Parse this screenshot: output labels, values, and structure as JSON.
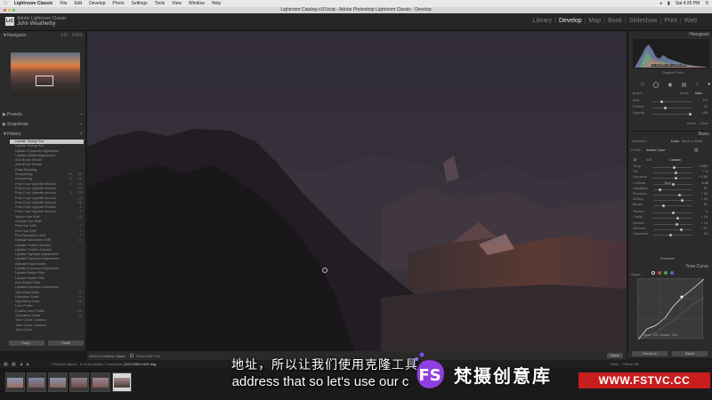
{
  "menubar": {
    "app_name": "Lightroom Classic",
    "items": [
      "File",
      "Edit",
      "Develop",
      "Photo",
      "Settings",
      "Tools",
      "View",
      "Window",
      "Help"
    ],
    "clock": "Sat 4:25 PM"
  },
  "window": {
    "title": "Lightroom Catalog-v10.lrcat - Adobe Photoshop Lightroom Classic - Develop"
  },
  "identity_plate": {
    "badge": "LrC",
    "line1": "Adobe Lightroom Classic",
    "name": "John Weatherby"
  },
  "modules": [
    {
      "label": "Library",
      "active": false
    },
    {
      "label": "Develop",
      "active": true
    },
    {
      "label": "Map",
      "active": false
    },
    {
      "label": "Book",
      "active": false
    },
    {
      "label": "Slideshow",
      "active": false
    },
    {
      "label": "Print",
      "active": false
    },
    {
      "label": "Web",
      "active": false
    }
  ],
  "left_panel": {
    "navigator": {
      "label": "Navigator",
      "zoom": "FIT",
      "zoom2": "100%"
    },
    "presets": "Presets",
    "snapshots": "Snapshots",
    "history": {
      "label": "History",
      "items": [
        {
          "text": "Update Toning Hue",
          "a": "",
          "b": ""
        },
        {
          "text": "Update Toning Hue",
          "a": "",
          "b": ""
        },
        {
          "text": "Update Exposure Adjustment",
          "a": "",
          "b": ""
        },
        {
          "text": "Update Whites Adjustment",
          "a": "",
          "b": ""
        },
        {
          "text": "Add Brush Stroke",
          "a": "",
          "b": ""
        },
        {
          "text": "Add Brush Stroke",
          "a": "",
          "b": ""
        },
        {
          "text": "Edge Masking",
          "a": "",
          "b": ""
        },
        {
          "text": "Sharpening",
          "a": "25",
          "b": "59"
        },
        {
          "text": "Sharpening",
          "a": "10",
          "b": "25"
        },
        {
          "text": "Post-Crop Vignette Amount",
          "a": "-4",
          "b": "-14"
        },
        {
          "text": "Post-Crop Vignette Feather",
          "a": "",
          "b": "53"
        },
        {
          "text": "Post-Crop Vignette Amount",
          "a": "4",
          "b": "-10"
        },
        {
          "text": "Post-Crop Vignette Amount",
          "a": "",
          "b": "-14"
        },
        {
          "text": "Post-Crop Vignette Amount",
          "a": "",
          "b": "-15"
        },
        {
          "text": "Post-Crop Vignette Feather",
          "a": "",
          "b": "0"
        },
        {
          "text": "Post-Crop Vignette Amount",
          "a": "",
          "b": "0"
        },
        {
          "text": "Yellow Hue Shift",
          "a": "",
          "b": "10"
        },
        {
          "text": "Orange Hue Shift",
          "a": "",
          "b": ""
        },
        {
          "text": "Red Hue Shift",
          "a": "",
          "b": "1"
        },
        {
          "text": "Red Hue Shift",
          "a": "",
          "b": "1"
        },
        {
          "text": "Red Saturation Shift",
          "a": "",
          "b": "1"
        },
        {
          "text": "Orange Saturation Shift",
          "a": "",
          "b": "10"
        },
        {
          "text": "Update Feather Amount",
          "a": "",
          "b": ""
        },
        {
          "text": "Update Feather Amount",
          "a": "",
          "b": ""
        },
        {
          "text": "Update Highlight Adjustment",
          "a": "",
          "b": ""
        },
        {
          "text": "Update Exposure Adjustment",
          "a": "",
          "b": ""
        },
        {
          "text": "Activate Mask Mode",
          "a": "",
          "b": ""
        },
        {
          "text": "Update Exposure Adjustment",
          "a": "",
          "b": ""
        },
        {
          "text": "Update Radial Filter",
          "a": "",
          "b": ""
        },
        {
          "text": "Update Radial Filter",
          "a": "",
          "b": ""
        },
        {
          "text": "Add Radial Filter",
          "a": "",
          "b": ""
        },
        {
          "text": "Update Exposure Adjustment",
          "a": "",
          "b": ""
        },
        {
          "text": "Vignetting Scale",
          "a": "",
          "b": "10"
        },
        {
          "text": "Distortion Scale",
          "a": "",
          "b": "10"
        },
        {
          "text": "Vignetting Scale",
          "a": "",
          "b": "10"
        },
        {
          "text": "Lens Profile",
          "a": "",
          "b": ""
        },
        {
          "text": "Enable Lens Profile",
          "a": "",
          "b": "On"
        },
        {
          "text": "Saturation Scale",
          "a": "",
          "b": "10"
        },
        {
          "text": "Tone Curve: Custom",
          "a": "",
          "b": ""
        },
        {
          "text": "Tone Curve: Custom",
          "a": "",
          "b": ""
        },
        {
          "text": "Tone Curve",
          "a": "",
          "b": ""
        }
      ]
    },
    "copy_label": "Copy...",
    "paste_label": "Paste"
  },
  "right_panel": {
    "histogram_label": "Histogram",
    "original_photo": "Original Photo",
    "histogram_readout": [
      "ISO",
      "24 mm",
      "f/8",
      "1/250 sec"
    ],
    "brush": {
      "label": "Brush :",
      "erase": "Erase",
      "new": "New"
    },
    "brush_rows": [
      {
        "label": "Size",
        "value": "5.0"
      },
      {
        "label": "Feather",
        "value": "32"
      },
      {
        "label": "Opacity",
        "value": "100"
      }
    ],
    "reset_label": "Reset",
    "close_label": "Close",
    "basic_label": "Basic",
    "treatment": {
      "label": "Treatment :",
      "color": "Color",
      "bw": "Black & White"
    },
    "profile": {
      "label": "Profile :",
      "value": "Adobe Color"
    },
    "wb": {
      "label": "WB :",
      "value": "Custom"
    },
    "basic_rows": [
      {
        "label": "Temp",
        "value": "3,863"
      },
      {
        "label": "Tint",
        "value": "+ 6"
      },
      {
        "label": "Exposure",
        "value": "+ 0.50"
      },
      {
        "label": "Contrast",
        "value": "0"
      },
      {
        "label": "Highlights",
        "value": "- 87"
      },
      {
        "label": "Shadows",
        "value": "+ 34"
      },
      {
        "label": "Whites",
        "value": "+ 43"
      },
      {
        "label": "Blacks",
        "value": "- 51"
      }
    ],
    "tone_label": "Tone",
    "auto_label": "Auto",
    "presence_label": "Presence",
    "presence_rows": [
      {
        "label": "Texture",
        "value": "0"
      },
      {
        "label": "Clarity",
        "value": "+ 16"
      },
      {
        "label": "Dehaze",
        "value": "+ 13"
      },
      {
        "label": "Vibrance",
        "value": "+ 27"
      },
      {
        "label": "Saturation",
        "value": "- 10"
      }
    ],
    "tone_curve_label": "Tone Curve",
    "tone_curve_channel": "Adjust :",
    "tone_curve_readout": {
      "input_label": "Input :",
      "input": "194",
      "output_label": "Output :",
      "output": "103"
    },
    "previous_label": "Previous",
    "reset_btn_label": "Reset"
  },
  "toolbar": {
    "before_after": "Before/After :",
    "mask_label": "Mask :",
    "mask_value": "None",
    "show_pins_label": "Show Edit Pins",
    "done_label": "Done"
  },
  "filmstrip_bar": {
    "source": "Previous Import",
    "count": "6 of 28 photos / 1 selected /",
    "filename": "_DSC9468-HDR.dng",
    "filter_label": "Filter :",
    "filter_value": "Filters Off"
  },
  "filmstrip": [
    {
      "selected": false,
      "colors": [
        "#8795b3",
        "#9b6d62"
      ]
    },
    {
      "selected": false,
      "colors": [
        "#7d88a8",
        "#7a5a58"
      ]
    },
    {
      "selected": false,
      "colors": [
        "#8a93af",
        "#88645c"
      ]
    },
    {
      "selected": false,
      "colors": [
        "#8c7f8e",
        "#6d4c48"
      ]
    },
    {
      "selected": false,
      "colors": [
        "#9a8794",
        "#7a5650"
      ]
    },
    {
      "selected": true,
      "colors": [
        "#a58d8b",
        "#4c3a38"
      ]
    }
  ],
  "subtitles": {
    "chinese": "地址，所以让我们使用克隆",
    "chinese_end": "工具",
    "english": "address that so let's use our c"
  },
  "watermark": {
    "logo_letters": "FS",
    "brand_cn": "梵摄创意库",
    "url": "WWW.FSTVC.CC"
  },
  "colors": {
    "panel": "#2b2b2b",
    "photo_sky": "#342f3b",
    "accent_active_module": "#e8e8e8",
    "watermark_red": "#c81e1e",
    "watermark_purple": "#7b4fe0"
  }
}
